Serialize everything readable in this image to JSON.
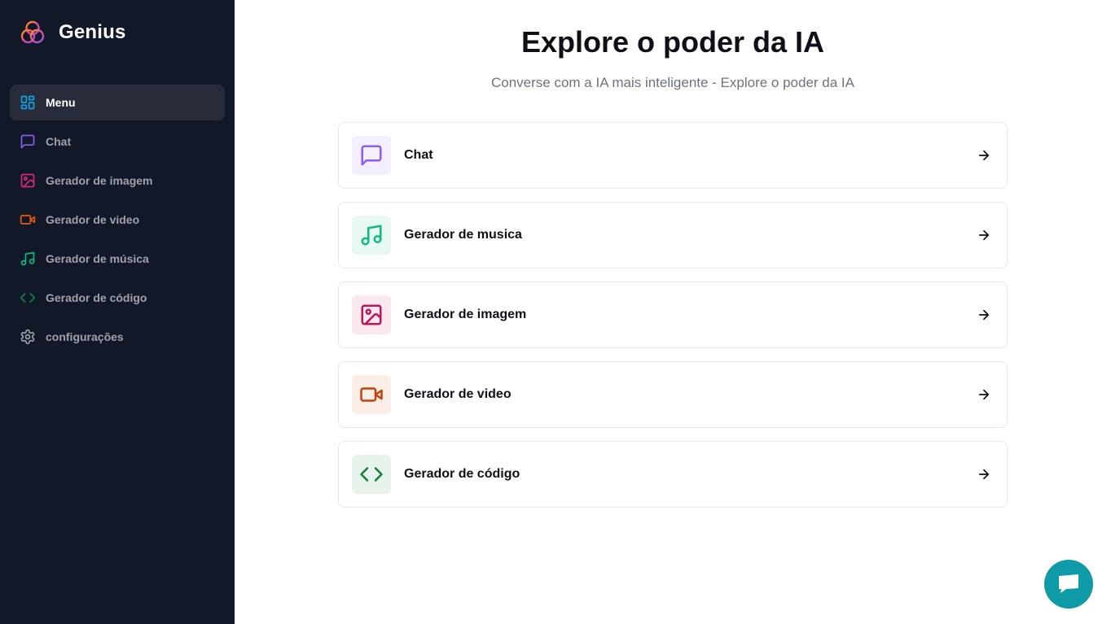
{
  "brand": {
    "name": "Genius"
  },
  "sidebar": {
    "items": [
      {
        "label": "Menu",
        "icon": "dashboard-icon",
        "color": "#0ea5e9",
        "active": true
      },
      {
        "label": "Chat",
        "icon": "chat-icon",
        "color": "#8b5cf6"
      },
      {
        "label": "Gerador de imagem",
        "icon": "image-icon",
        "color": "#db2777"
      },
      {
        "label": "Gerador de video",
        "icon": "video-icon",
        "color": "#ea580c"
      },
      {
        "label": "Gerador de música",
        "icon": "music-icon",
        "color": "#10b981"
      },
      {
        "label": "Gerador de código",
        "icon": "code-icon",
        "color": "#15803d"
      },
      {
        "label": "configurações",
        "icon": "settings-icon",
        "color": "#a1a1aa"
      }
    ]
  },
  "hero": {
    "title": "Explore o poder da IA",
    "subtitle": "Converse com a IA mais inteligente - Explore o poder da IA"
  },
  "cards": [
    {
      "label": "Chat",
      "icon": "chat-icon",
      "color": "#8b5cf6",
      "bg": "#f3effe"
    },
    {
      "label": "Gerador de musica",
      "icon": "music-icon",
      "color": "#10b981",
      "bg": "#e8f8f2"
    },
    {
      "label": "Gerador de imagem",
      "icon": "image-icon",
      "color": "#be185d",
      "bg": "#fbe9ef"
    },
    {
      "label": "Gerador de video",
      "icon": "video-icon",
      "color": "#c2410c",
      "bg": "#fbeee6"
    },
    {
      "label": "Gerador de código",
      "icon": "code-icon",
      "color": "#15803d",
      "bg": "#e8f3ec"
    }
  ],
  "colors": {
    "sidebar_bg": "#111827",
    "fab": "#0e9aa6"
  }
}
